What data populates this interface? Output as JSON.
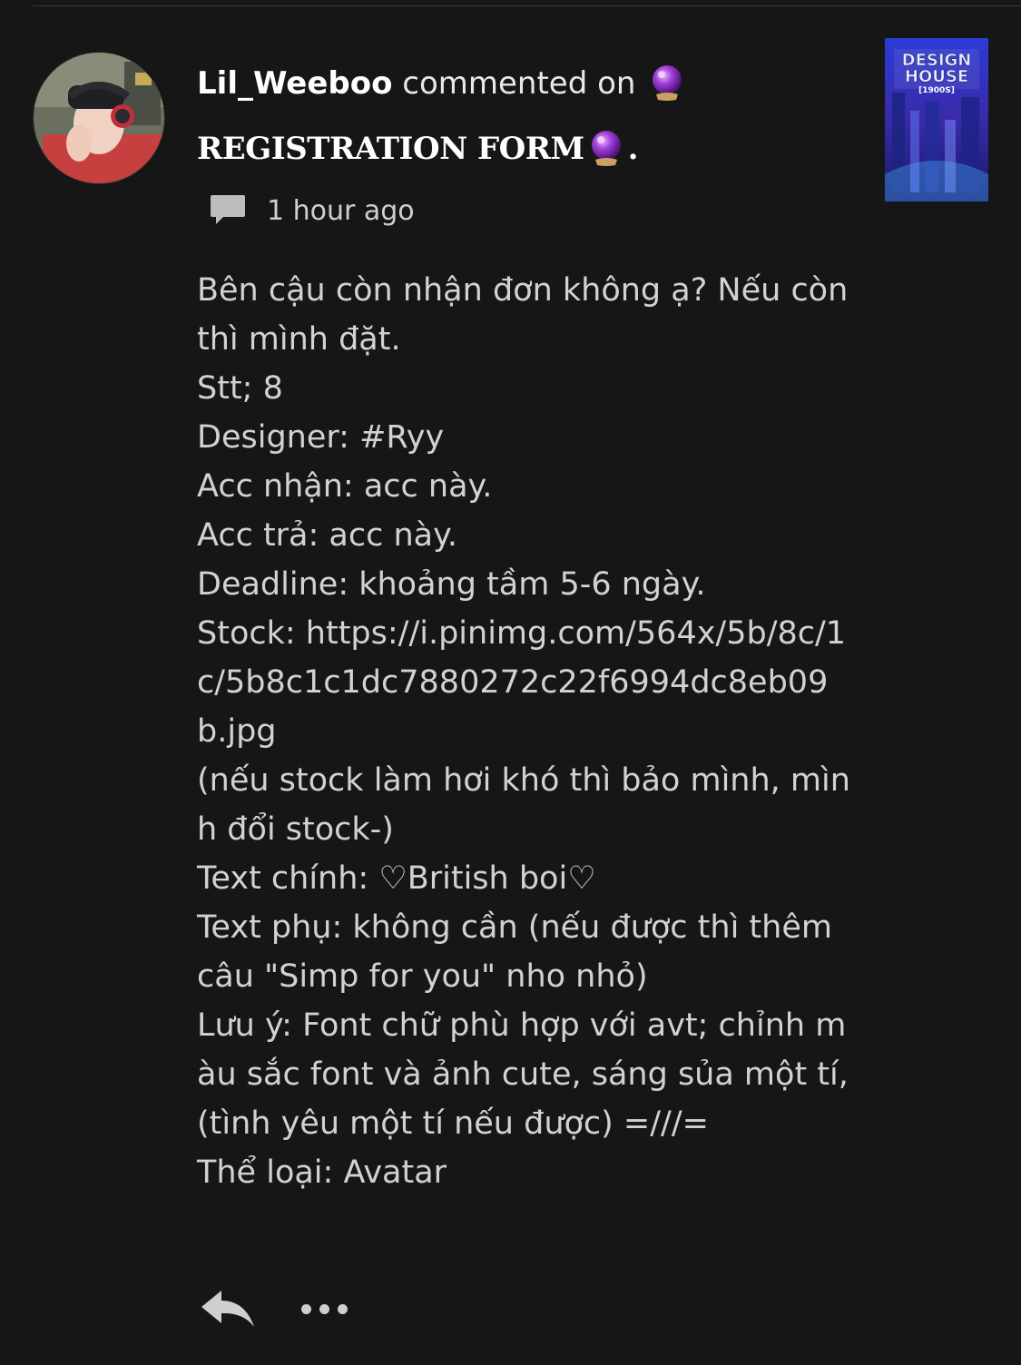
{
  "comment": {
    "username": "Lil_Weeboo",
    "action_text": "commented on",
    "story_title": "REGISTRATION FORM",
    "title_trailing": ".",
    "timestamp": "1 hour ago",
    "orb_icon": "crystal-ball-icon",
    "thumbnail_icon": "design-house-cover-icon",
    "body_lines": [
      "Bên cậu còn nhận đơn không ạ? Nếu còn thì mình đặt.",
      "Stt; 8",
      "Designer: #Ryy",
      "Acc nhận: acc này.",
      "Acc trả: acc này.",
      "Deadline: khoảng tầm 5-6 ngày.",
      "Stock: https://i.pinimg.com/564x/5b/8c/1c/5b8c1c1dc7880272c22f6994dc8eb09b.jpg",
      "(nếu stock làm hơi khó thì bảo mình, mình đổi stock-)",
      "Text chính: ♡British boi♡",
      "Text phụ: không cần (nếu được thì thêm câu \"Simp for you\" nho nhỏ)",
      "Lưu ý: Font chữ phù hợp với avt; chỉnh màu sắc font và ảnh cute, sáng sủa một tí, (tình yêu một tí nếu được) =///=",
      "Thể loại: Avatar"
    ]
  },
  "actions": {
    "reply_icon": "reply-icon",
    "more_icon": "more-options-icon"
  },
  "colors": {
    "background": "#161616",
    "text": "#d2d2d2",
    "accent_orb": "#9b30c8"
  }
}
